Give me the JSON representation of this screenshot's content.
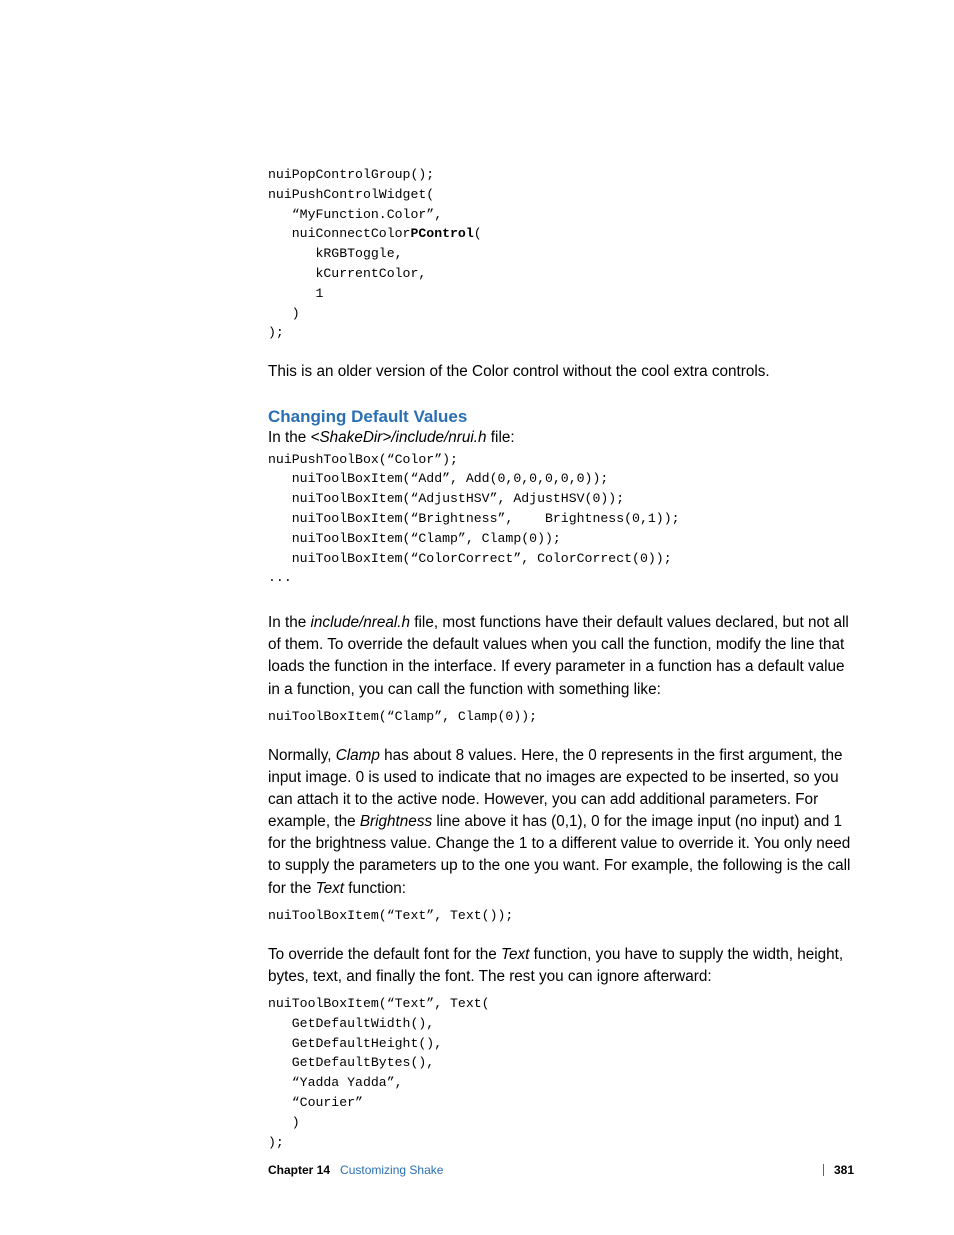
{
  "code1_l1": "nuiPopControlGroup();",
  "code1_l2": "nuiPushControlWidget(",
  "code1_l3": "   “MyFunction.Color”,",
  "code1_l4a": "   nuiConnectColor",
  "code1_l4b": "PControl",
  "code1_l4c": "(",
  "code1_l5": "      kRGBToggle,",
  "code1_l6": "      kCurrentColor,",
  "code1_l7": "      1",
  "code1_l8": "   )",
  "code1_l9": ");",
  "para1": "This is an older version of the Color control without the cool extra controls.",
  "heading1": "Changing Default Values",
  "para2_a": "In the ",
  "para2_em": "<ShakeDir>/include/nrui.h",
  "para2_b": " file:",
  "code2_l1": "nuiPushToolBox(“Color”);",
  "code2_l2": "   nuiToolBoxItem(“Add”, Add(0,0,0,0,0,0));",
  "code2_l3": "   nuiToolBoxItem(“AdjustHSV”, AdjustHSV(0));",
  "code2_l4": "   nuiToolBoxItem(“Brightness”,    Brightness(0,1));",
  "code2_l5": "   nuiToolBoxItem(“Clamp”, Clamp(0));",
  "code2_l6": "   nuiToolBoxItem(“ColorCorrect”, ColorCorrect(0));",
  "code2_l7": "...",
  "para3_a": "In the ",
  "para3_em": "include/nreal.h",
  "para3_b": " file, most functions have their default values declared, but not all of them. To override the default values when you call the function, modify the line that loads the function in the interface. If every parameter in a function has a default value in a function, you can call the function with something like:",
  "code3": "nuiToolBoxItem(“Clamp”, Clamp(0));",
  "para4_a": "Normally, ",
  "para4_em1": "Clamp",
  "para4_b": " has about 8 values. Here, the 0 represents in the first argument, the input image. 0 is used to indicate that no images are expected to be inserted, so you can attach it to the active node. However, you can add additional parameters. For example, the ",
  "para4_em2": "Brightness",
  "para4_c": " line above it has (0,1), 0 for the image input (no input) and 1 for the brightness value. Change the 1 to a different value to override it. You only need to supply the parameters up to the one you want. For example, the following is the call for the ",
  "para4_em3": "Text",
  "para4_d": " function:",
  "code4": "nuiToolBoxItem(“Text”, Text());",
  "para5_a": "To override the default font for the ",
  "para5_em": "Text",
  "para5_b": " function, you have to supply the width, height, bytes, text, and finally the font. The rest you can ignore afterward:",
  "code5_l1": "nuiToolBoxItem(“Text”, Text(",
  "code5_l2": "   GetDefaultWidth(),",
  "code5_l3": "   GetDefaultHeight(),",
  "code5_l4": "   GetDefaultBytes(),",
  "code5_l5": "   “Yadda Yadda”,",
  "code5_l6": "   “Courier”",
  "code5_l7": "   )",
  "code5_l8": ");",
  "footer_chapter": "Chapter 14",
  "footer_title": "Customizing Shake",
  "footer_page": "381"
}
